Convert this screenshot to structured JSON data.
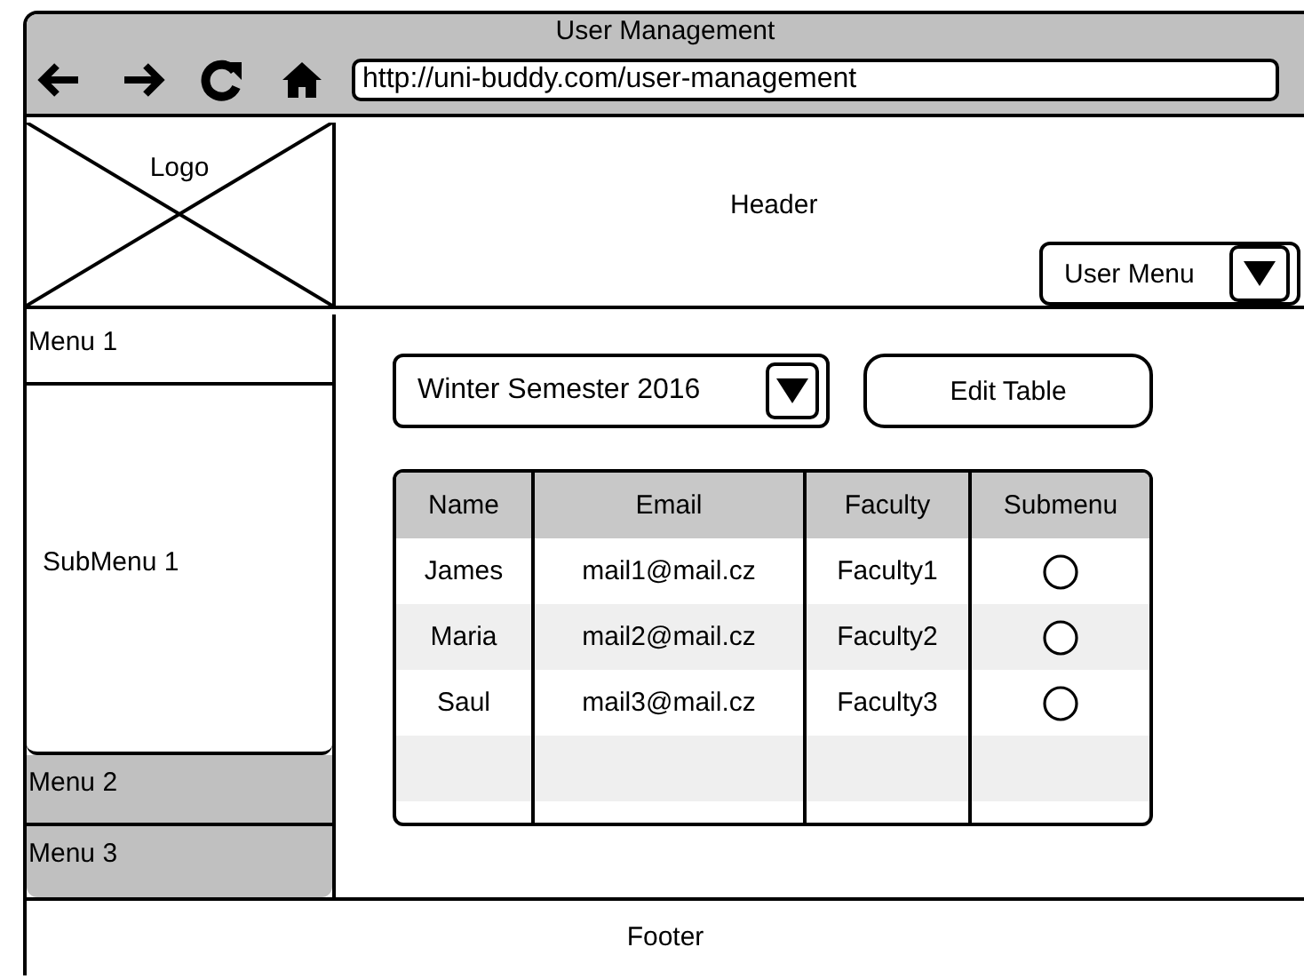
{
  "window": {
    "title": "User Management",
    "url": "http://uni-buddy.com/user-management"
  },
  "header": {
    "logo": "Logo",
    "title": "Header",
    "user_menu": "User Menu"
  },
  "sidebar": {
    "items": [
      {
        "label": "Menu 1",
        "expanded": true,
        "children": [
          {
            "label": "SubMenu 1"
          }
        ]
      },
      {
        "label": "Menu 2",
        "expanded": false
      },
      {
        "label": "Menu 3",
        "expanded": false
      }
    ]
  },
  "toolbar": {
    "semester": "Winter Semester 2016",
    "edit_button": "Edit Table"
  },
  "table": {
    "columns": [
      "Name",
      "Email",
      "Faculty",
      "Submenu"
    ],
    "rows": [
      {
        "name": "James",
        "email": "mail1@mail.cz",
        "faculty": "Faculty1",
        "selected": false
      },
      {
        "name": "Maria",
        "email": "mail2@mail.cz",
        "faculty": "Faculty2",
        "selected": false
      },
      {
        "name": "Saul",
        "email": "mail3@mail.cz",
        "faculty": "Faculty3",
        "selected": false
      }
    ]
  },
  "footer": {
    "text": "Footer"
  }
}
